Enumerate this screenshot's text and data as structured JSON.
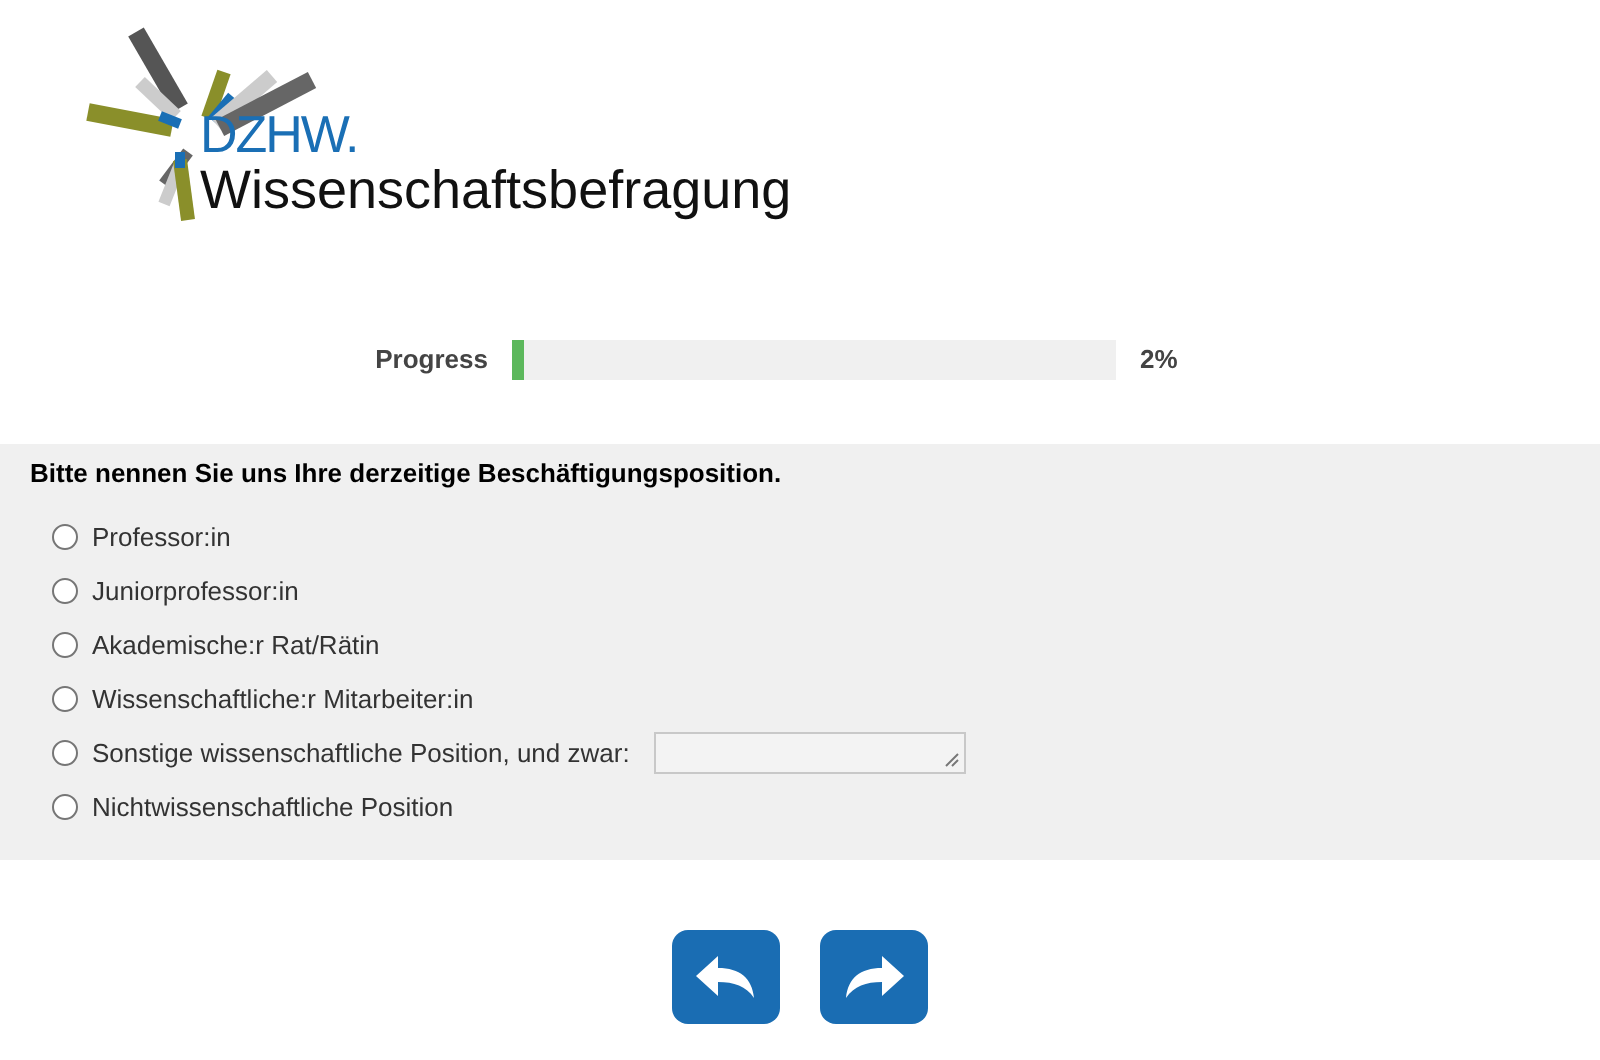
{
  "logo": {
    "acronym": "DZHW.",
    "name": "Wissenschaftsbefragung"
  },
  "progress": {
    "label": "Progress",
    "level": 0.02,
    "reading": "2%"
  },
  "question": {
    "text": "Bitte nennen Sie uns Ihre derzeitige Beschäftigungsposition.",
    "options": [
      {
        "kind": "plain",
        "label": "Professor:in",
        "selected": false
      },
      {
        "kind": "plain",
        "label": "Juniorprofessor:in",
        "selected": false
      },
      {
        "kind": "plain",
        "label": "Akademische:r Rat/Rätin",
        "selected": false
      },
      {
        "kind": "plain",
        "label": "Wissenschaftliche:r Mitarbeiter:in",
        "selected": false
      },
      {
        "kind": "text_input",
        "label": "Sonstige wissenschaftliche Position, und zwar:",
        "selected": false
      },
      {
        "kind": "plain",
        "label": "Nichtwissenschaftliche Position",
        "selected": false
      }
    ]
  },
  "navigation": [
    {
      "kind": "back"
    },
    {
      "kind": "forward"
    }
  ]
}
